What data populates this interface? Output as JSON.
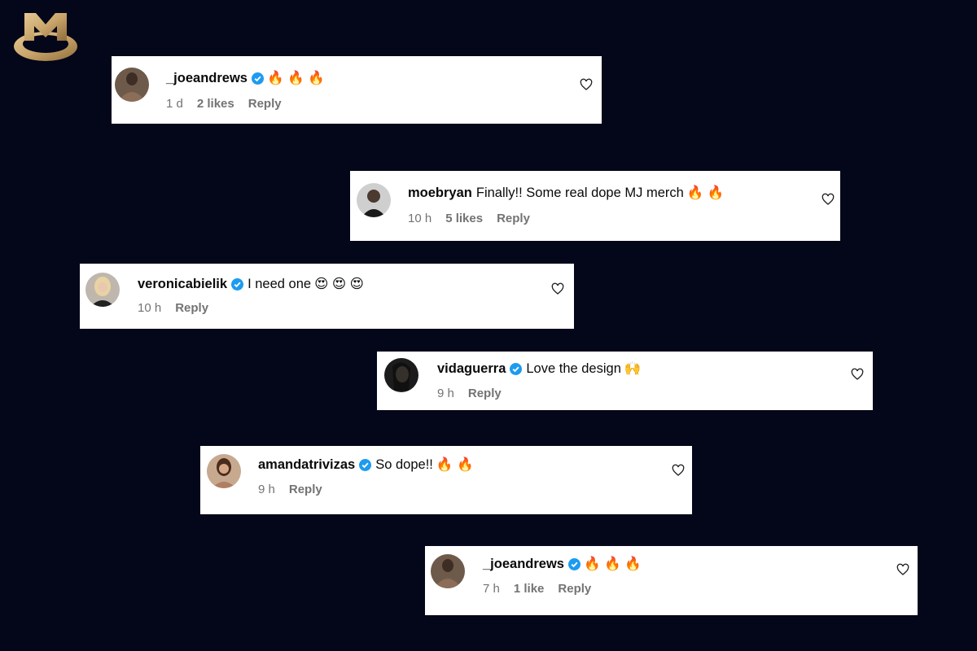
{
  "brand": {
    "logo_icon": "mj-monogram-logo",
    "colors": {
      "background": "#04061a",
      "gold": "#c9a56b"
    }
  },
  "comments": [
    {
      "username": "_joeandrews",
      "verified": true,
      "text": "",
      "emoji": "🔥 🔥 🔥",
      "time": "1 d",
      "likes": "2 likes",
      "reply": "Reply"
    },
    {
      "username": "moebryan",
      "verified": false,
      "text": "Finally!! Some real dope MJ merch",
      "emoji": "🔥 🔥",
      "time": "10 h",
      "likes": "5 likes",
      "reply": "Reply"
    },
    {
      "username": "veronicabielik",
      "verified": true,
      "text": "I need one",
      "emoji": "😍 😍 😍",
      "time": "10 h",
      "likes": "",
      "reply": "Reply"
    },
    {
      "username": "vidaguerra",
      "verified": true,
      "text": "Love the design",
      "emoji": "🙌",
      "time": "9 h",
      "likes": "",
      "reply": "Reply"
    },
    {
      "username": "amandatrivizas",
      "verified": true,
      "text": "So dope!!",
      "emoji": "🔥 🔥",
      "time": "9 h",
      "likes": "",
      "reply": "Reply"
    },
    {
      "username": "_joeandrews",
      "verified": true,
      "text": "",
      "emoji": "🔥 🔥 🔥",
      "time": "7 h",
      "likes": "1 like",
      "reply": "Reply"
    }
  ]
}
